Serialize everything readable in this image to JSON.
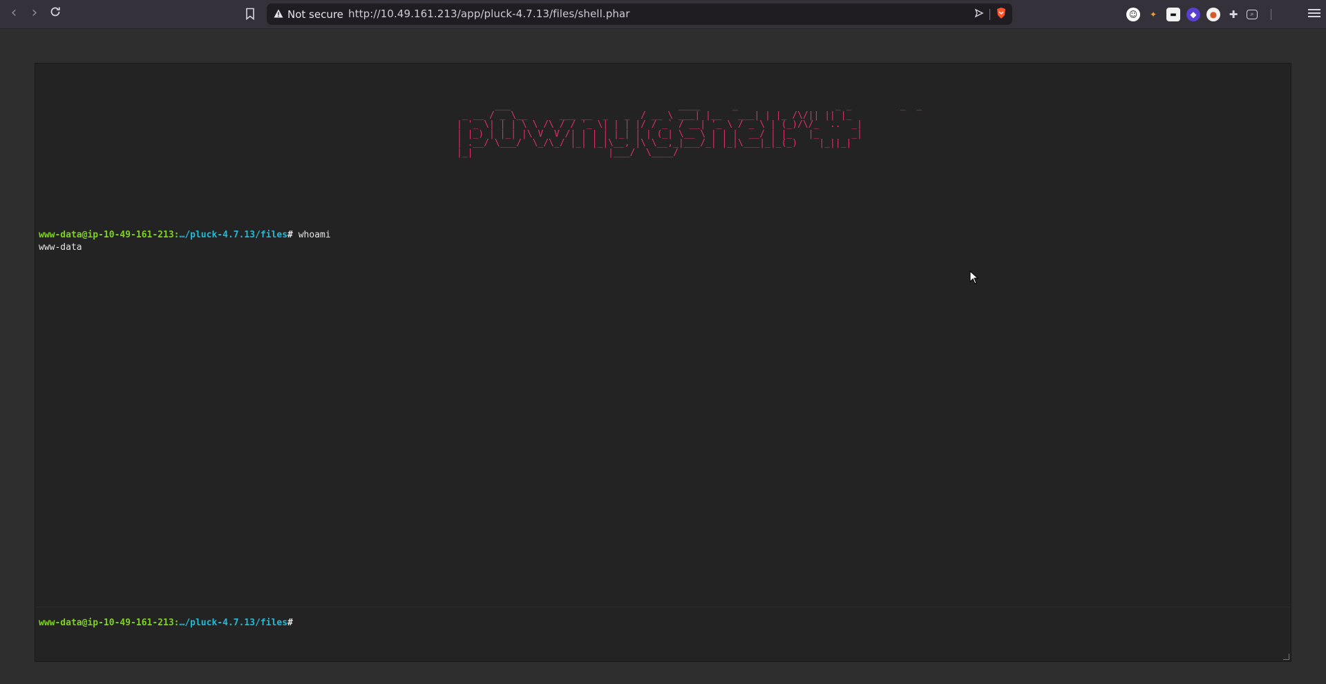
{
  "browser": {
    "security_label": "Not secure",
    "url": "http://10.49.161.213/app/pluck-4.7.13/files/shell.phar",
    "icons": [
      "back-icon",
      "forward-icon",
      "reload-icon",
      "bookmark-icon",
      "warning-icon",
      "share-icon",
      "brave-shield-icon",
      "extension-icon",
      "puzzle-icon",
      "menu-icon"
    ]
  },
  "terminal": {
    "banner": "       ___                               ____      _                  _ _         _  _\n _ __ / _ \\__      ___ __  _   _  / __ \\ ___| |__   ___| | |_ /\\/|| || |_\n| '_ \\| | | \\ \\ /\\ / / '_ \\| | | |/ / _` / __| '_ \\ / _ \\ | (_)/\\/_  ..  _|\n| |_) | |_| |\\ V  V /| | | | |_| | | (_| \\__ \\ | | |  __/ | |_   |_      _|\n| .__/ \\___/  \\_/\\_/ |_| |_|\\__, |\\ \\__,_|___/_| |_|\\___|_|_(_)    |_||_|\n|_|                         |___/  \\____/",
    "history": [
      {
        "user_host": "www-data@ip-10-49-161-213",
        "colon": ":",
        "path": "…/pluck-4.7.13/files",
        "hash": "#",
        "command": "whoami",
        "output": "www-data"
      }
    ],
    "prompt": {
      "user_host": "www-data@ip-10-49-161-213",
      "colon": ":",
      "path": "…/pluck-4.7.13/files",
      "hash": "#"
    },
    "input_value": ""
  }
}
